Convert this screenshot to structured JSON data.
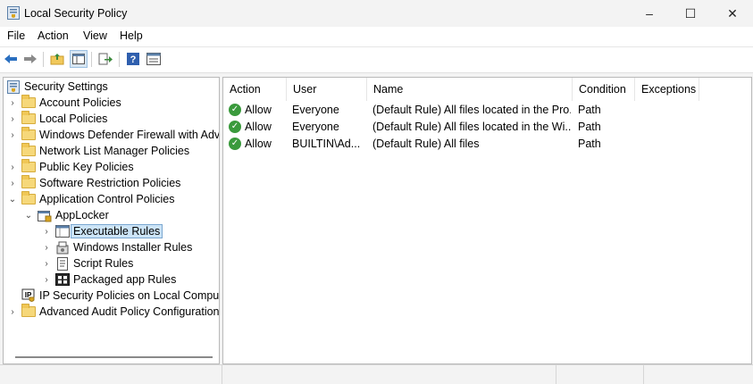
{
  "window": {
    "title": "Local Security Policy",
    "icon": "security-policy-icon",
    "controls": {
      "minimize": "–",
      "maximize": "☐",
      "close": "✕"
    }
  },
  "menu": [
    "File",
    "Action",
    "View",
    "Help"
  ],
  "toolbar": {
    "icons": [
      "back-arrow-icon",
      "forward-arrow-icon",
      "up-folder-icon",
      "show-hide-tree-icon",
      "export-list-icon",
      "help-icon",
      "properties-icon"
    ]
  },
  "tree": {
    "root": "Security Settings",
    "items": [
      {
        "label": "Account Policies"
      },
      {
        "label": "Local Policies"
      },
      {
        "label": "Windows Defender Firewall with Adva"
      },
      {
        "label": "Network List Manager Policies"
      },
      {
        "label": "Public Key Policies"
      },
      {
        "label": "Software Restriction Policies"
      },
      {
        "label": "Application Control Policies"
      },
      {
        "label": "AppLocker"
      },
      {
        "label": "Executable Rules"
      },
      {
        "label": "Windows Installer Rules"
      },
      {
        "label": "Script Rules"
      },
      {
        "label": "Packaged app Rules"
      },
      {
        "label": "IP Security Policies on Local Compute"
      },
      {
        "label": "Advanced Audit Policy Configuration"
      }
    ]
  },
  "table": {
    "columns": [
      "Action",
      "User",
      "Name",
      "Condition",
      "Exceptions"
    ],
    "rows": [
      [
        "Allow",
        "Everyone",
        "(Default Rule) All files located in the Pro...",
        "Path",
        ""
      ],
      [
        "Allow",
        "Everyone",
        "(Default Rule) All files located in the Wi...",
        "Path",
        ""
      ],
      [
        "Allow",
        "BUILTIN\\Ad...",
        "(Default Rule) All files",
        "Path",
        ""
      ]
    ],
    "status_icon": "green-check-icon",
    "accent": "#3a9a3c"
  },
  "colors": {
    "selection": "#cce4f7",
    "folder": "#f6d87a"
  }
}
